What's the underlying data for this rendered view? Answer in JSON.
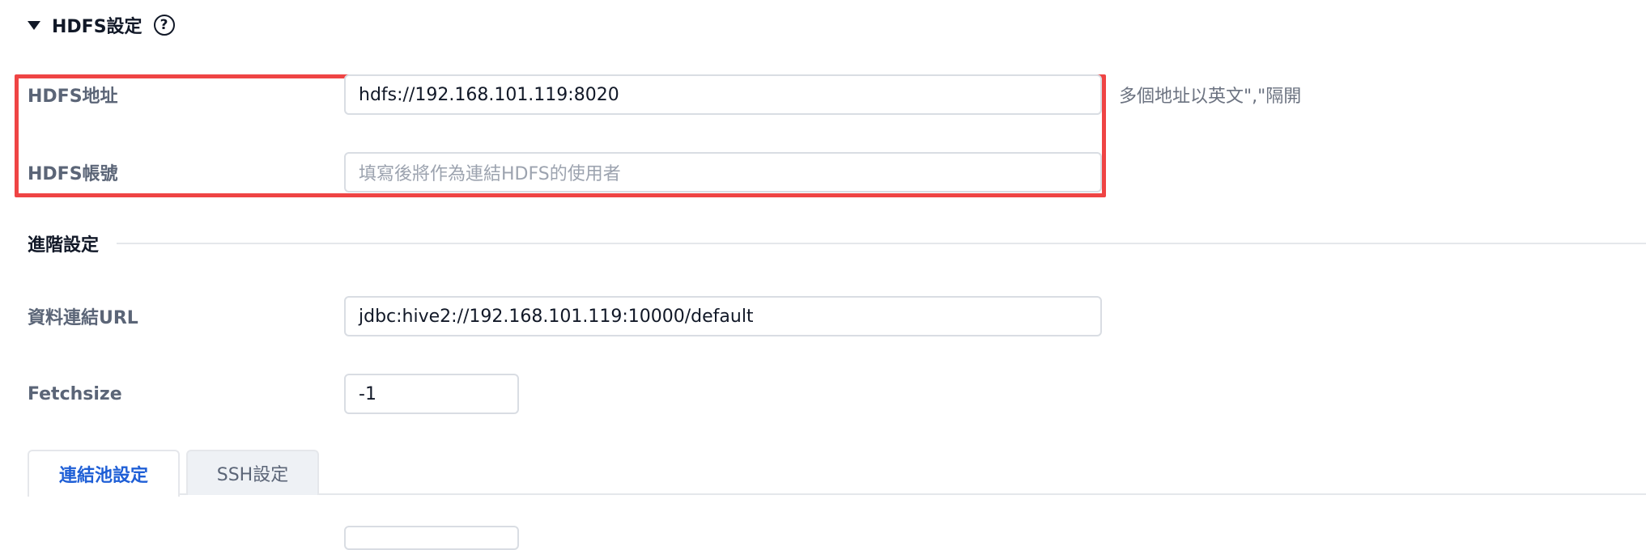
{
  "hdfs_section": {
    "title": "HDFS設定",
    "help_icon_glyph": "?",
    "address": {
      "label": "HDFS地址",
      "value": "hdfs://192.168.101.119:8020",
      "hint": "多個地址以英文\",\"隔開"
    },
    "account": {
      "label": "HDFS帳號",
      "placeholder": "填寫後將作為連結HDFS的使用者"
    },
    "highlight_color": "#ef4444"
  },
  "advanced": {
    "title": "進階設定",
    "jdbc_url": {
      "label": "資料連結URL",
      "value": "jdbc:hive2://192.168.101.119:10000/default"
    },
    "fetchsize": {
      "label": "Fetchsize",
      "value": "-1"
    }
  },
  "tabs": [
    {
      "label": "連結池設定",
      "active": true
    },
    {
      "label": "SSH設定",
      "active": false
    }
  ],
  "colors": {
    "accent": "#1f5fd6",
    "label": "#5b6577",
    "border": "#d9dde3"
  }
}
